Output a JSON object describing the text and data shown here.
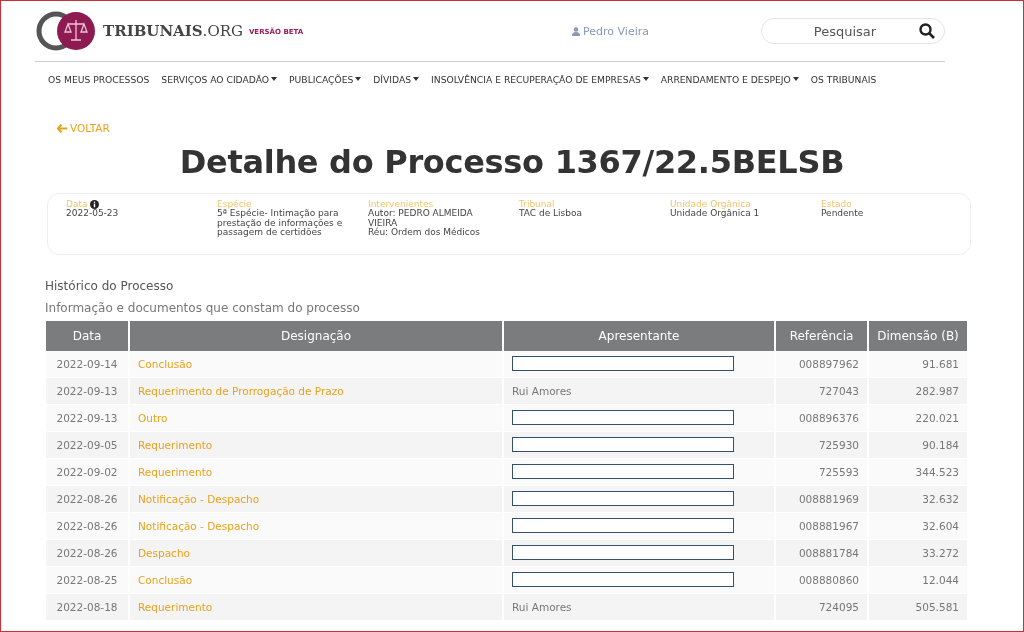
{
  "header": {
    "logo_text": "TRIBUNAIS",
    "logo_suffix": ".ORG",
    "beta_label": "VERSÃO BETA",
    "user_name": "Pedro Vieira",
    "search": {
      "placeholder": "Pesquisar"
    }
  },
  "nav": [
    {
      "label": "OS MEUS PROCESSOS",
      "dropdown": false
    },
    {
      "label": "SERVIÇOS AO CIDADÃO",
      "dropdown": true
    },
    {
      "label": "PUBLICAÇÕES",
      "dropdown": true
    },
    {
      "label": "DÍVIDAS",
      "dropdown": true
    },
    {
      "label": "INSOLVÊNCIA E RECUPERAÇÃO DE EMPRESAS",
      "dropdown": true
    },
    {
      "label": "ARRENDAMENTO E DESPEJO",
      "dropdown": true
    },
    {
      "label": "OS TRIBUNAIS",
      "dropdown": false
    }
  ],
  "back_link": "VOLTAR",
  "title": "Detalhe do Processo 1367/22.5BELSB",
  "details": [
    {
      "label": "Data",
      "info": true,
      "lines": [
        "2022-05-23"
      ]
    },
    {
      "label": "Espécie",
      "info": false,
      "lines": [
        "5ª Espécie- Intimação para prestação de informações e passagem de certidões"
      ]
    },
    {
      "label": "Intervenientes",
      "info": false,
      "lines": [
        "Autor: PEDRO ALMEIDA VIEIRA",
        "Réu: Ordem dos Médicos"
      ]
    },
    {
      "label": "Tribunal",
      "info": false,
      "lines": [
        "TAC de Lisboa"
      ]
    },
    {
      "label": "Unidade Orgânica",
      "info": false,
      "lines": [
        "Unidade Orgânica 1"
      ]
    },
    {
      "label": "Estado",
      "info": false,
      "lines": [
        "Pendente"
      ]
    }
  ],
  "history": {
    "heading": "Histórico do Processo",
    "subtitle": "Informação e documentos que constam do processo",
    "table": {
      "columns": [
        "Data",
        "Designação",
        "Apresentante",
        "Referência",
        "Dimensão (B)"
      ],
      "rows": [
        {
          "date": "2022-09-14",
          "designation": "Conclusão",
          "presenter": {
            "kind": "redacted"
          },
          "reference": "008897962",
          "size": "91.681"
        },
        {
          "date": "2022-09-13",
          "designation": "Requerimento de Prorrogação de Prazo",
          "presenter": {
            "kind": "text",
            "text": "Rui Amores"
          },
          "reference": "727043",
          "size": "282.987"
        },
        {
          "date": "2022-09-13",
          "designation": "Outro",
          "presenter": {
            "kind": "redacted"
          },
          "reference": "008896376",
          "size": "220.021"
        },
        {
          "date": "2022-09-05",
          "designation": "Requerimento",
          "presenter": {
            "kind": "redacted"
          },
          "reference": "725930",
          "size": "90.184"
        },
        {
          "date": "2022-09-02",
          "designation": "Requerimento",
          "presenter": {
            "kind": "redacted"
          },
          "reference": "725593",
          "size": "344.523"
        },
        {
          "date": "2022-08-26",
          "designation": "Notificação - Despacho",
          "presenter": {
            "kind": "redacted"
          },
          "reference": "008881969",
          "size": "32.632"
        },
        {
          "date": "2022-08-26",
          "designation": "Notificação - Despacho",
          "presenter": {
            "kind": "redacted"
          },
          "reference": "008881967",
          "size": "32.604"
        },
        {
          "date": "2022-08-26",
          "designation": "Despacho",
          "presenter": {
            "kind": "redacted"
          },
          "reference": "008881784",
          "size": "33.272"
        },
        {
          "date": "2022-08-25",
          "designation": "Conclusão",
          "presenter": {
            "kind": "redacted"
          },
          "reference": "008880860",
          "size": "12.044"
        },
        {
          "date": "2022-08-18",
          "designation": "Requerimento",
          "presenter": {
            "kind": "text",
            "text": "Rui Amores"
          },
          "reference": "724095",
          "size": "505.581"
        }
      ]
    }
  }
}
